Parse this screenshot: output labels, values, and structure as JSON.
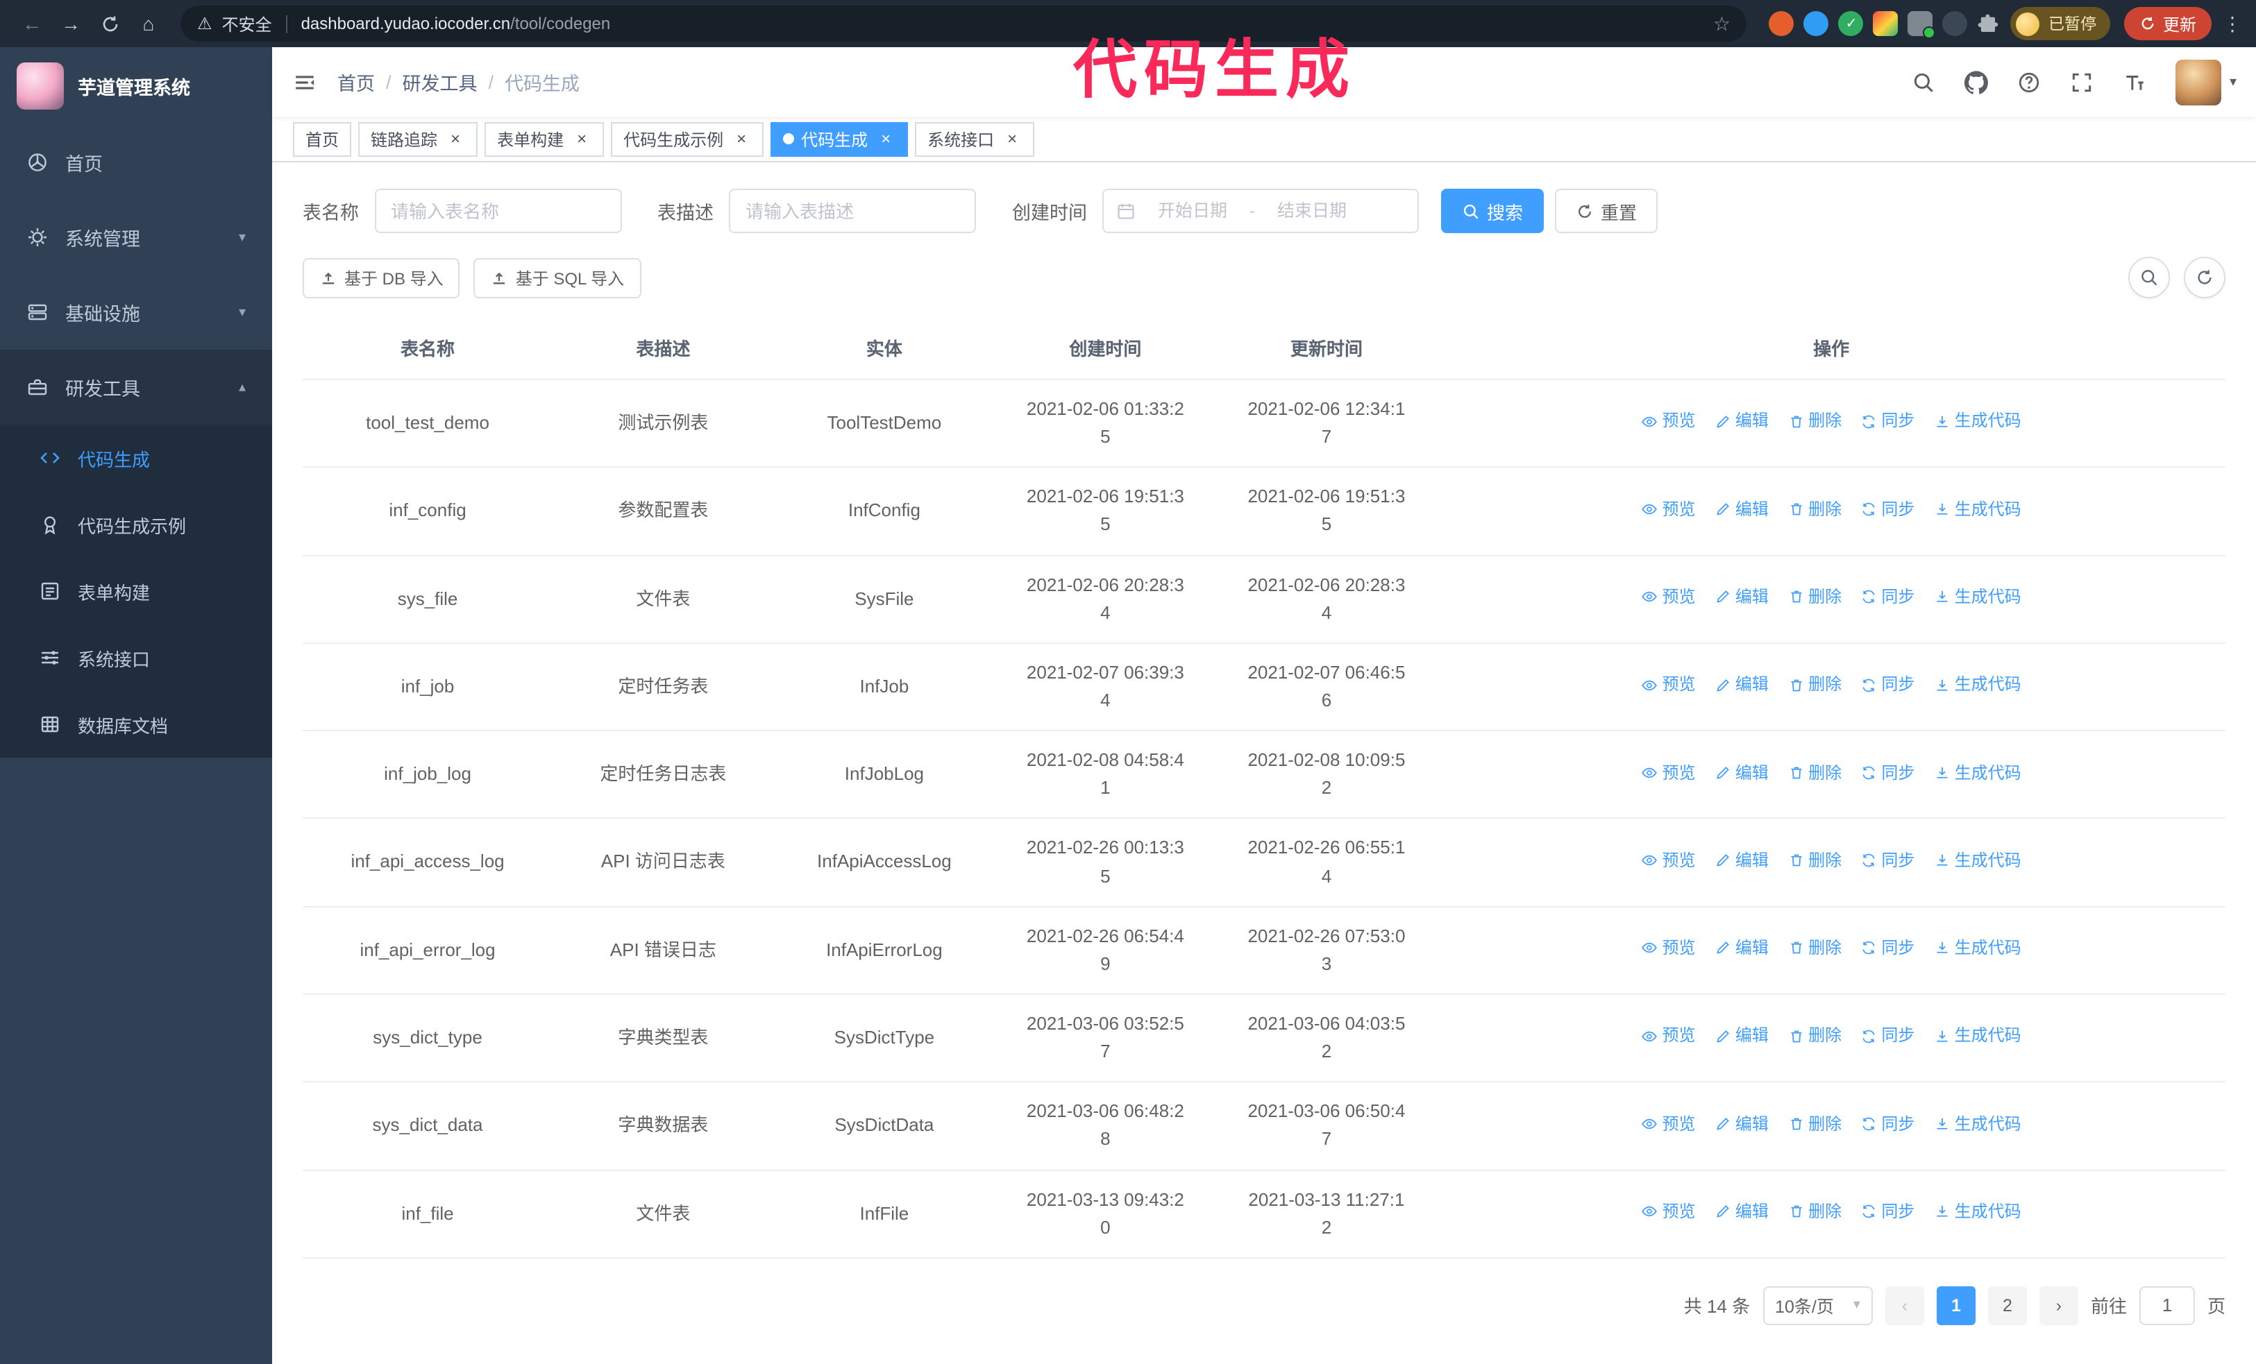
{
  "browser": {
    "security_label": "不安全",
    "url_host": "dashboard.yudao.iocoder.cn",
    "url_path": "/tool/codegen",
    "profile_chip": "已暂停",
    "update_button": "更新"
  },
  "annotation": "代码生成",
  "sidebar": {
    "title": "芋道管理系统",
    "items": [
      {
        "label": "首页"
      },
      {
        "label": "系统管理"
      },
      {
        "label": "基础设施"
      },
      {
        "label": "研发工具",
        "expanded": true
      }
    ],
    "dev_sub": [
      {
        "label": "代码生成",
        "active": true
      },
      {
        "label": "代码生成示例"
      },
      {
        "label": "表单构建"
      },
      {
        "label": "系统接口"
      },
      {
        "label": "数据库文档"
      }
    ]
  },
  "breadcrumb": {
    "items": [
      "首页",
      "研发工具",
      "代码生成"
    ],
    "separator": "/"
  },
  "tabs": [
    {
      "label": "首页",
      "closable": false
    },
    {
      "label": "链路追踪",
      "closable": true
    },
    {
      "label": "表单构建",
      "closable": true
    },
    {
      "label": "代码生成示例",
      "closable": true
    },
    {
      "label": "代码生成",
      "closable": true,
      "active": true
    },
    {
      "label": "系统接口",
      "closable": true
    }
  ],
  "filters": {
    "name_label": "表名称",
    "name_placeholder": "请输入表名称",
    "desc_label": "表描述",
    "desc_placeholder": "请输入表描述",
    "time_label": "创建时间",
    "start_placeholder": "开始日期",
    "separator": "-",
    "end_placeholder": "结束日期",
    "search": "搜索",
    "reset": "重置"
  },
  "toolbar": {
    "import_db": "基于 DB 导入",
    "import_sql": "基于 SQL 导入"
  },
  "table": {
    "columns": [
      "表名称",
      "表描述",
      "实体",
      "创建时间",
      "更新时间",
      "操作"
    ],
    "actions": [
      "预览",
      "编辑",
      "删除",
      "同步",
      "生成代码"
    ],
    "rows": [
      {
        "name": "tool_test_demo",
        "desc": "测试示例表",
        "entity": "ToolTestDemo",
        "created": "2021-02-06 01:33:25",
        "updated": "2021-02-06 12:34:17"
      },
      {
        "name": "inf_config",
        "desc": "参数配置表",
        "entity": "InfConfig",
        "created": "2021-02-06 19:51:35",
        "updated": "2021-02-06 19:51:35"
      },
      {
        "name": "sys_file",
        "desc": "文件表",
        "entity": "SysFile",
        "created": "2021-02-06 20:28:34",
        "updated": "2021-02-06 20:28:34"
      },
      {
        "name": "inf_job",
        "desc": "定时任务表",
        "entity": "InfJob",
        "created": "2021-02-07 06:39:34",
        "updated": "2021-02-07 06:46:56"
      },
      {
        "name": "inf_job_log",
        "desc": "定时任务日志表",
        "entity": "InfJobLog",
        "created": "2021-02-08 04:58:41",
        "updated": "2021-02-08 10:09:52"
      },
      {
        "name": "inf_api_access_log",
        "desc": "API 访问日志表",
        "entity": "InfApiAccessLog",
        "created": "2021-02-26 00:13:35",
        "updated": "2021-02-26 06:55:14"
      },
      {
        "name": "inf_api_error_log",
        "desc": "API 错误日志",
        "entity": "InfApiErrorLog",
        "created": "2021-02-26 06:54:49",
        "updated": "2021-02-26 07:53:03"
      },
      {
        "name": "sys_dict_type",
        "desc": "字典类型表",
        "entity": "SysDictType",
        "created": "2021-03-06 03:52:57",
        "updated": "2021-03-06 04:03:52"
      },
      {
        "name": "sys_dict_data",
        "desc": "字典数据表",
        "entity": "SysDictData",
        "created": "2021-03-06 06:48:28",
        "updated": "2021-03-06 06:50:47"
      },
      {
        "name": "inf_file",
        "desc": "文件表",
        "entity": "InfFile",
        "created": "2021-03-13 09:43:20",
        "updated": "2021-03-13 11:27:12"
      }
    ]
  },
  "pagination": {
    "total": "共 14 条",
    "page_size": "10条/页",
    "pages": [
      "1",
      "2"
    ],
    "active_page": "1",
    "goto_label": "前往",
    "goto_value": "1",
    "unit_label": "页"
  },
  "colors": {
    "accent": "#409eff",
    "sidebar_bg": "#304156",
    "submenu_bg": "#1f2d3d",
    "annotation": "#f9295a"
  }
}
